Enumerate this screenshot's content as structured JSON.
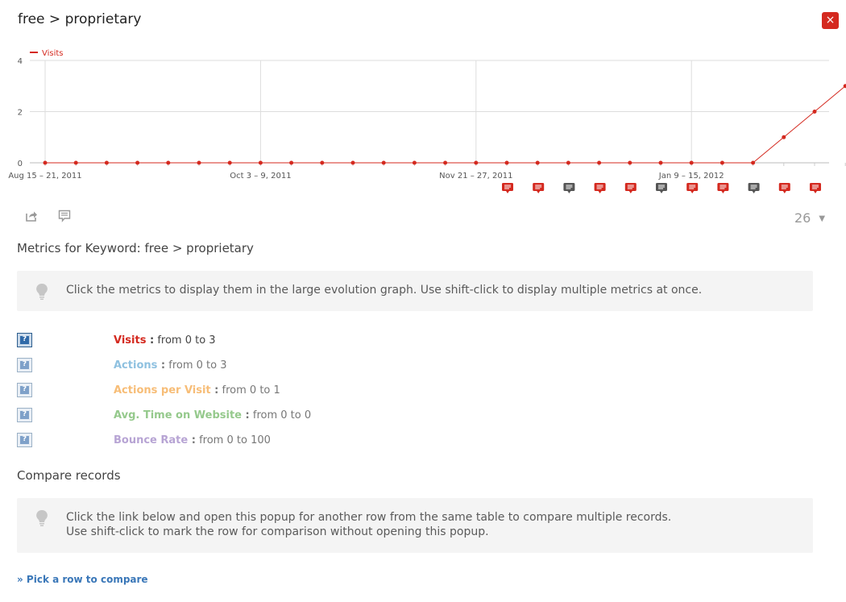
{
  "header": {
    "title": "free > proprietary",
    "close_label": "×"
  },
  "chart_data": {
    "type": "line",
    "title": "",
    "xlabel": "",
    "ylabel": "",
    "ylim": [
      0,
      4
    ],
    "yticks": [
      0,
      2,
      4
    ],
    "grid": true,
    "legend_placement": "top-left",
    "x_labels": [
      {
        "index": 0,
        "text": "Aug 15 – 21, 2011"
      },
      {
        "index": 7,
        "text": "Oct 3 – 9, 2011"
      },
      {
        "index": 14,
        "text": "Nov 21 – 27, 2011"
      },
      {
        "index": 21,
        "text": "Jan 9 – 15, 2012"
      }
    ],
    "series": [
      {
        "name": "Visits",
        "color": "#d4291f",
        "values": [
          0,
          0,
          0,
          0,
          0,
          0,
          0,
          0,
          0,
          0,
          0,
          0,
          0,
          0,
          0,
          0,
          0,
          0,
          0,
          0,
          0,
          0,
          0,
          0,
          1,
          2,
          3
        ]
      }
    ],
    "annotations": [
      {
        "index": 15,
        "starred": true
      },
      {
        "index": 16,
        "starred": true
      },
      {
        "index": 17,
        "starred": false
      },
      {
        "index": 18,
        "starred": true
      },
      {
        "index": 19,
        "starred": true
      },
      {
        "index": 20,
        "starred": false
      },
      {
        "index": 21,
        "starred": true
      },
      {
        "index": 22,
        "starred": true
      },
      {
        "index": 23,
        "starred": false
      },
      {
        "index": 24,
        "starred": true
      },
      {
        "index": 25,
        "starred": true
      }
    ],
    "annotation_colors": {
      "starred": "#d4291f",
      "normal": "#555555"
    }
  },
  "footer": {
    "export_icon": "share-icon",
    "annotations_icon": "comment-icon",
    "period_count": "26",
    "period_caret": "▼"
  },
  "metrics": {
    "heading": "Metrics for Keyword: free > proprietary",
    "hint": "Click the metrics to display them in the large evolution graph. Use shift-click to display multiple metrics at once.",
    "items": [
      {
        "name": "Visits",
        "sep": " :",
        "range": "from 0 to 3",
        "color": "#d4291f",
        "selected": true
      },
      {
        "name": "Actions",
        "sep": " :",
        "range": "from 0 to 3",
        "color": "#8fc1e0",
        "selected": false
      },
      {
        "name": "Actions per Visit",
        "sep": " :",
        "range": "from 0 to 1",
        "color": "#f7bd77",
        "selected": false
      },
      {
        "name": "Avg. Time on Website",
        "sep": " :",
        "range": "from 0 to 0",
        "color": "#95c98c",
        "selected": false
      },
      {
        "name": "Bounce Rate",
        "sep": " :",
        "range": "from 0 to 100",
        "color": "#b7a4d4",
        "selected": false
      }
    ],
    "help_glyph": "?"
  },
  "compare": {
    "heading": "Compare records",
    "hint_line1": "Click the link below and open this popup for another row from the same table to compare multiple records.",
    "hint_line2": "Use shift-click to mark the row for comparison without opening this popup.",
    "link": "» Pick a row to compare"
  }
}
